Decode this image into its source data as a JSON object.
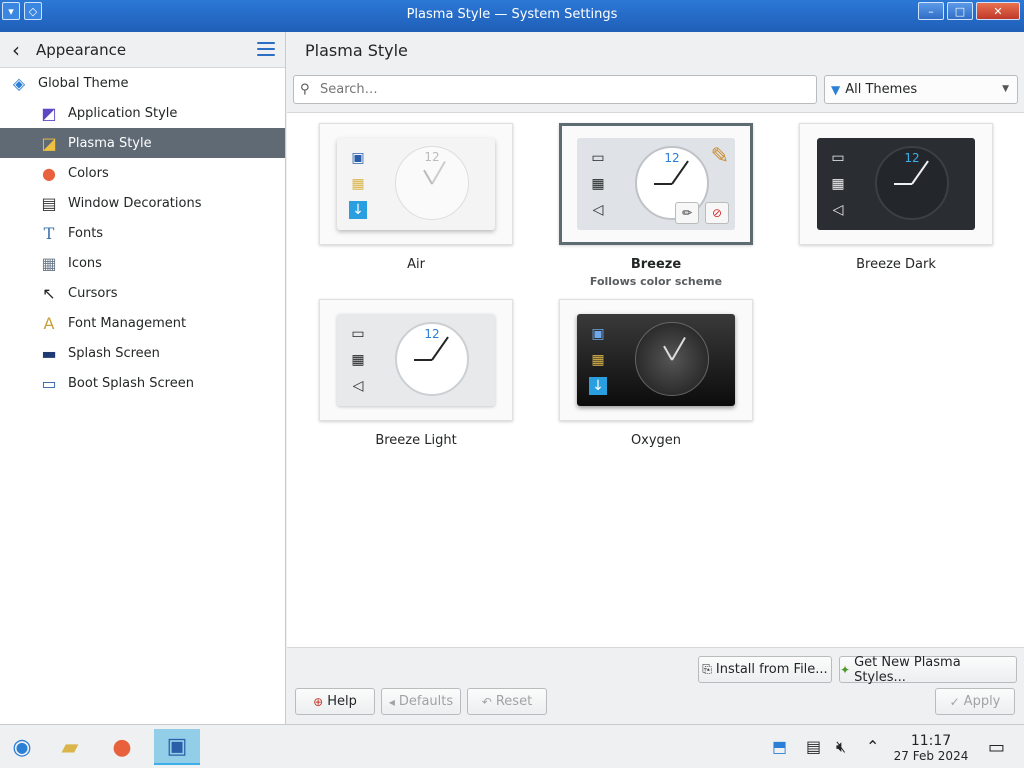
{
  "window": {
    "title": "Plasma Style — System Settings",
    "buttons": {
      "minimize": "–",
      "maximize": "□",
      "close": "✕"
    }
  },
  "sidebar": {
    "title": "Appearance",
    "items": [
      {
        "label": "Global Theme",
        "icon": "global-theme-icon",
        "glyph": "◈"
      },
      {
        "label": "Application Style",
        "icon": "application-style-icon",
        "glyph": "◩"
      },
      {
        "label": "Plasma Style",
        "icon": "plasma-style-icon",
        "glyph": "◪"
      },
      {
        "label": "Colors",
        "icon": "colors-icon",
        "glyph": "●"
      },
      {
        "label": "Window Decorations",
        "icon": "window-decorations-icon",
        "glyph": "▤"
      },
      {
        "label": "Fonts",
        "icon": "fonts-icon",
        "glyph": "T"
      },
      {
        "label": "Icons",
        "icon": "icons-icon",
        "glyph": "▦"
      },
      {
        "label": "Cursors",
        "icon": "cursors-icon",
        "glyph": "↖"
      },
      {
        "label": "Font Management",
        "icon": "font-management-icon",
        "glyph": "A"
      },
      {
        "label": "Splash Screen",
        "icon": "splash-screen-icon",
        "glyph": "▬"
      },
      {
        "label": "Boot Splash Screen",
        "icon": "boot-splash-screen-icon",
        "glyph": "▭"
      }
    ]
  },
  "main": {
    "title": "Plasma Style",
    "search_placeholder": "Search…",
    "filter": "All Themes",
    "themes": [
      {
        "name": "Air",
        "subtitle": "",
        "clock_number": "12"
      },
      {
        "name": "Breeze",
        "subtitle": "Follows color scheme",
        "clock_number": "12"
      },
      {
        "name": "Breeze Dark",
        "subtitle": "",
        "clock_number": "12"
      },
      {
        "name": "Breeze Light",
        "subtitle": "",
        "clock_number": "12"
      },
      {
        "name": "Oxygen",
        "subtitle": "",
        "clock_number": ""
      }
    ],
    "buttons": {
      "install": "Install from File...",
      "get_new": "Get New Plasma Styles...",
      "help": "Help",
      "defaults": "Defaults",
      "reset": "Reset",
      "apply": "Apply"
    }
  },
  "taskbar": {
    "time": "11:17",
    "date": "27 Feb 2024"
  },
  "colors": {
    "accent": "#3daee9",
    "selection": "#5f6a75"
  }
}
